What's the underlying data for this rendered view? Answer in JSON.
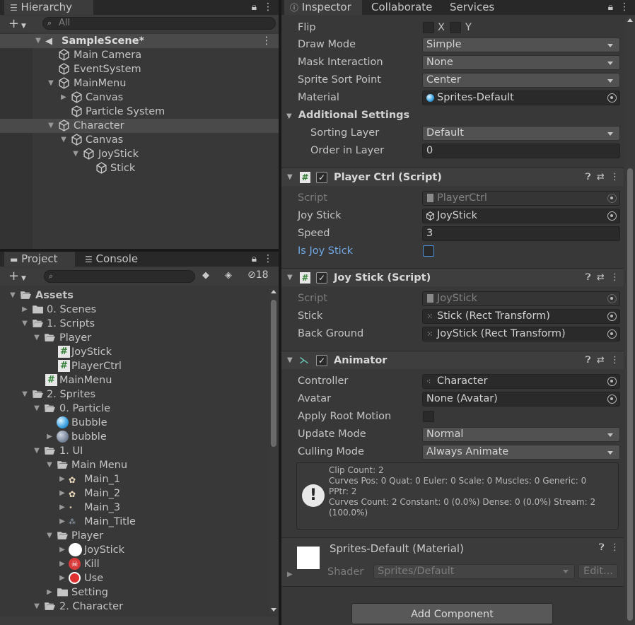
{
  "hierarchy": {
    "tab_label": "Hierarchy",
    "search_placeholder": "All",
    "rows": [
      {
        "label": "SampleScene*"
      },
      {
        "label": "Main Camera"
      },
      {
        "label": "EventSystem"
      },
      {
        "label": "MainMenu"
      },
      {
        "label": "Canvas"
      },
      {
        "label": "Particle System"
      },
      {
        "label": "Character"
      },
      {
        "label": "Canvas"
      },
      {
        "label": "JoyStick"
      },
      {
        "label": "Stick"
      }
    ]
  },
  "project": {
    "tabs": [
      "Project",
      "Console"
    ],
    "count_badge": "18",
    "rows": [
      {
        "label": "Assets"
      },
      {
        "label": "0. Scenes"
      },
      {
        "label": "1. Scripts"
      },
      {
        "label": "Player"
      },
      {
        "label": "JoyStick"
      },
      {
        "label": "PlayerCtrl"
      },
      {
        "label": "MainMenu"
      },
      {
        "label": "2. Sprites"
      },
      {
        "label": "0. Particle"
      },
      {
        "label": "Bubble"
      },
      {
        "label": "bubble"
      },
      {
        "label": "1. UI"
      },
      {
        "label": "Main Menu"
      },
      {
        "label": "Main_1"
      },
      {
        "label": "Main_2"
      },
      {
        "label": "Main_3"
      },
      {
        "label": "Main_Title"
      },
      {
        "label": "Player"
      },
      {
        "label": "JoyStick"
      },
      {
        "label": "Kill"
      },
      {
        "label": "Use"
      },
      {
        "label": "Setting"
      },
      {
        "label": "2. Character"
      }
    ]
  },
  "inspector": {
    "tabs": [
      "Inspector",
      "Collaborate",
      "Services"
    ],
    "sprite": {
      "flip_label": "Flip",
      "flip_x": "X",
      "flip_y": "Y",
      "draw_mode_label": "Draw Mode",
      "draw_mode": "Simple",
      "mask_label": "Mask Interaction",
      "mask": "None",
      "sort_point_label": "Sprite Sort Point",
      "sort_point": "Center",
      "material_label": "Material",
      "material": "Sprites-Default",
      "additional_label": "Additional Settings",
      "sorting_layer_label": "Sorting Layer",
      "sorting_layer": "Default",
      "order_label": "Order in Layer",
      "order": "0"
    },
    "player_ctrl": {
      "title": "Player Ctrl (Script)",
      "script_label": "Script",
      "script": "PlayerCtrl",
      "joystick_label": "Joy Stick",
      "joystick": "JoyStick",
      "speed_label": "Speed",
      "speed": "3",
      "is_joystick_label": "Is Joy Stick"
    },
    "joy_stick": {
      "title": "Joy Stick (Script)",
      "script_label": "Script",
      "script": "JoyStick",
      "stick_label": "Stick",
      "stick": "Stick (Rect Transform)",
      "background_label": "Back Ground",
      "background": "JoyStick (Rect Transform)"
    },
    "animator": {
      "title": "Animator",
      "controller_label": "Controller",
      "controller": "Character",
      "avatar_label": "Avatar",
      "avatar": "None (Avatar)",
      "root_motion_label": "Apply Root Motion",
      "update_mode_label": "Update Mode",
      "update_mode": "Normal",
      "culling_label": "Culling Mode",
      "culling": "Always Animate",
      "info_line1": "Clip Count: 2",
      "info_line2": "Curves Pos: 0 Quat: 0 Euler: 0 Scale: 0 Muscles: 0 Generic: 0",
      "info_line3": "PPtr: 2",
      "info_line4": "Curves Count: 2 Constant: 0 (0.0%) Dense: 0 (0.0%) Stream: 2",
      "info_line5": "(100.0%)"
    },
    "material": {
      "title": "Sprites-Default (Material)",
      "shader_label": "Shader",
      "shader": "Sprites/Default",
      "edit_label": "Edit..."
    },
    "add_component": "Add Component"
  }
}
